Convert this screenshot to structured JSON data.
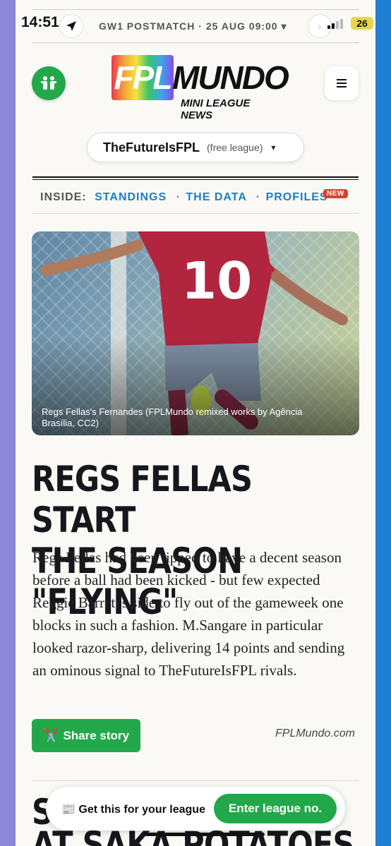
{
  "status_bar": {
    "time": "14:51",
    "battery": "26"
  },
  "gameweek_bar": {
    "label": "GW1 POSTMATCH · 25 AUG 09:00 ▾",
    "next": "›"
  },
  "header": {
    "logo_fpl": "FPL",
    "logo_mundo": "MUNDO",
    "logo_subtitle": "MINI LEAGUE NEWS",
    "menu_icon": "≡"
  },
  "league_selector": {
    "name": "TheFutureIsFPL",
    "type": "(free league)",
    "caret": "▾"
  },
  "inside_nav": {
    "label": "INSIDE:",
    "links": [
      "STANDINGS",
      "THE DATA",
      "PROFILES"
    ],
    "separator": "·",
    "badge": "NEW"
  },
  "article": {
    "image_caption": "Regs Fellas's Fernandes (FPLMundo remixed works by Agência Brasília, CC2)",
    "headline_line1": "REGS FELLAS START",
    "headline_line2": "THE SEASON \"FLYING\"",
    "body": "Regs Fellas had been tipped to have a decent season before a ball had been kicked - but few expected Reggie Barrett's side to fly out of the gameweek one blocks in such a fashion. M.Sangare in particular looked razor-sharp, delivering 14 points and sending an ominous signal to TheFutureIsFPL rivals.",
    "share_label": "Share story",
    "share_icon": "✂️",
    "source": "FPLMundo.com"
  },
  "next_article": {
    "headline_line1": "S",
    "headline_line2": "AT SAKA POTATOES"
  },
  "cta": {
    "text": "Get this for your league",
    "icon": "📰",
    "button": "Enter league no."
  },
  "colors": {
    "green": "#22a84a",
    "link_blue": "#1a7fc4",
    "badge_red": "#d9432f"
  }
}
